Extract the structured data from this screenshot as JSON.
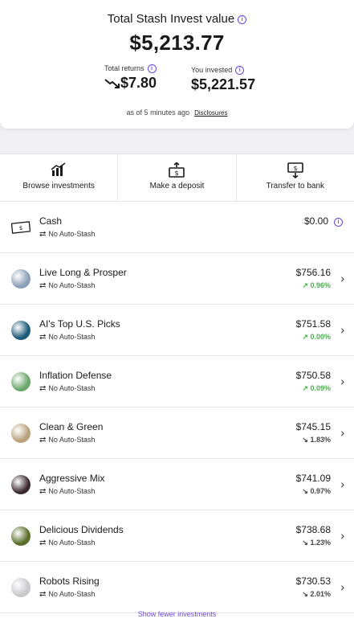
{
  "summary": {
    "title": "Total Stash Invest value",
    "total_value": "$5,213.77",
    "returns_label": "Total returns",
    "returns_value": "$7.80",
    "invested_label": "You invested",
    "invested_value": "$5,221.57",
    "as_of": "as of 5 minutes ago",
    "disclosures": "Disclosures"
  },
  "actions": [
    {
      "label": "Browse investments",
      "icon": "bar-chart-icon"
    },
    {
      "label": "Make a deposit",
      "icon": "deposit-icon"
    },
    {
      "label": "Transfer to bank",
      "icon": "transfer-icon"
    }
  ],
  "cash": {
    "name": "Cash",
    "sub": "No Auto-Stash",
    "amount": "$0.00"
  },
  "investments": [
    {
      "name": "Live Long & Prosper",
      "sub": "No Auto-Stash",
      "amount": "$756.16",
      "change": "0.96%",
      "direction": "up",
      "color": "#8aa0b8"
    },
    {
      "name": "AI's Top U.S. Picks",
      "sub": "No Auto-Stash",
      "amount": "$751.58",
      "change": "0.00%",
      "direction": "up",
      "color": "#1d5a7a"
    },
    {
      "name": "Inflation Defense",
      "sub": "No Auto-Stash",
      "amount": "$750.58",
      "change": "0.09%",
      "direction": "up",
      "color": "#6aa86a"
    },
    {
      "name": "Clean & Green",
      "sub": "No Auto-Stash",
      "amount": "$745.15",
      "change": "1.83%",
      "direction": "down",
      "color": "#b9a27a"
    },
    {
      "name": "Aggressive Mix",
      "sub": "No Auto-Stash",
      "amount": "$741.09",
      "change": "0.97%",
      "direction": "down",
      "color": "#3a2a2e"
    },
    {
      "name": "Delicious Dividends",
      "sub": "No Auto-Stash",
      "amount": "$738.68",
      "change": "1.23%",
      "direction": "down",
      "color": "#5b6e2a"
    },
    {
      "name": "Robots Rising",
      "sub": "No Auto-Stash",
      "amount": "$730.53",
      "change": "2.01%",
      "direction": "down",
      "color": "#c8c8cc"
    }
  ],
  "footer": "Show fewer investments",
  "colors": {
    "accent": "#6b47d8",
    "up": "#4cae4f",
    "down": "#444444"
  }
}
